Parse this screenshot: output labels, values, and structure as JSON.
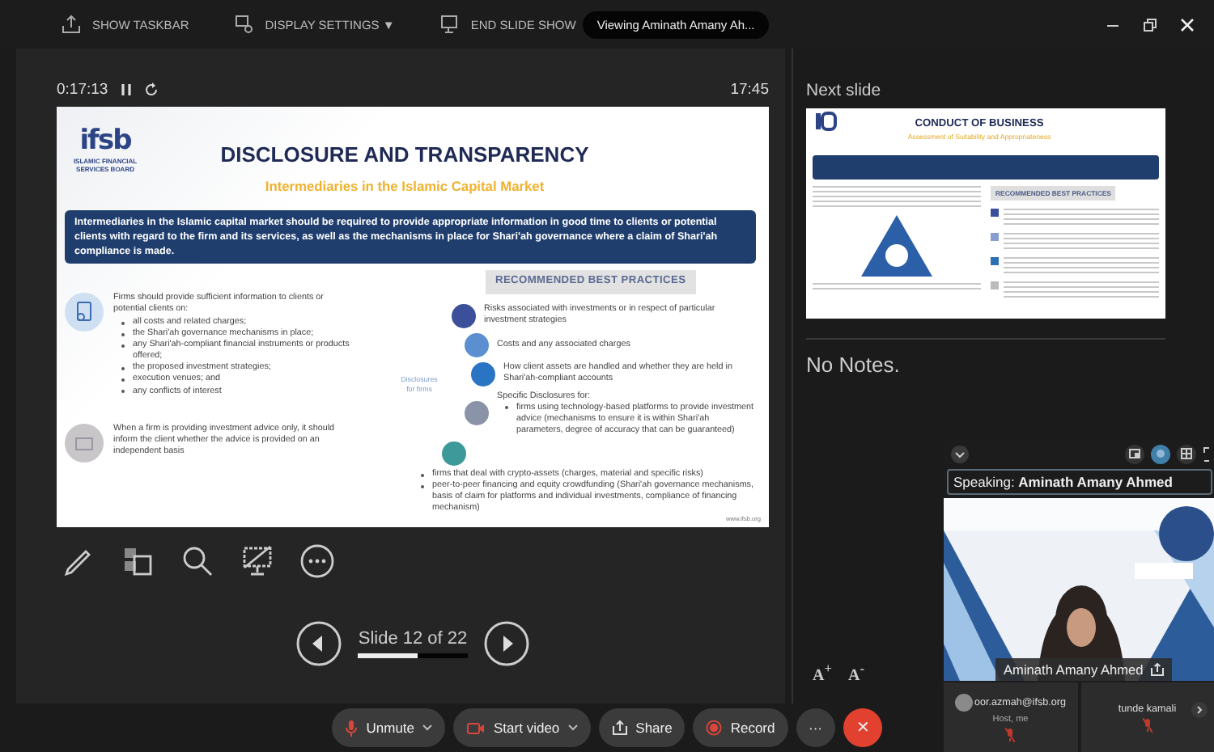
{
  "top_bar": {
    "items": [
      {
        "label": "SHOW TASKBAR",
        "kind": "taskbar"
      },
      {
        "label": "DISPLAY SETTINGS ▼",
        "kind": "display"
      },
      {
        "label": "END SLIDE SHOW",
        "kind": "end"
      }
    ],
    "viewing_badge": "Viewing Aminath Amany Ah..."
  },
  "presenter": {
    "elapsed": "0:17:13",
    "clock": "17:45"
  },
  "slide": {
    "logo": "ifsb",
    "logo_caption": "ISLAMIC FINANCIAL SERVICES BOARD",
    "title": "DISCLOSURE AND TRANSPARENCY",
    "subtitle": "Intermediaries in the Islamic Capital Market",
    "banner": "Intermediaries in the Islamic capital market should be required to provide appropriate information in good time to clients or potential clients with regard to the firm and its services, as well as the mechanisms in place for Shari'ah governance where a claim of Shari'ah compliance is made.",
    "left_blocks": [
      {
        "text": "Firms should provide sufficient information to clients or potential clients on:",
        "bullets": [
          "all costs and related charges;",
          "the Shari'ah governance mechanisms in place;",
          "any Shari'ah-compliant financial instruments or products offered;",
          "the proposed investment strategies;",
          "execution venues; and",
          "any conflicts of interest"
        ]
      },
      {
        "text": "When a firm is providing investment advice only, it should inform the client whether the advice is provided on an independent basis"
      }
    ],
    "practices_heading": "RECOMMENDED BEST PRACTICES",
    "hub_label": "Disclosures for firms",
    "practices": [
      {
        "text": "Risks associated with investments or in respect of particular investment strategies",
        "color": "#3b4f9a"
      },
      {
        "text": "Costs and any associated charges",
        "color": "#5b8fd0"
      },
      {
        "text": "How client assets are handled and whether they are held in Shari'ah-compliant accounts",
        "color": "#2a74c4"
      },
      {
        "text": "Specific Disclosures for:",
        "color": "#8a93a8",
        "bullets": [
          "firms using technology-based platforms to provide investment advice (mechanisms to ensure it is within Shari'ah parameters, degree of accuracy that can be guaranteed)"
        ]
      }
    ],
    "more_bullets": [
      "firms that deal with crypto-assets (charges, material and specific risks)",
      "peer-to-peer financing and equity crowdfunding (Shari'ah governance mechanisms, basis of claim for platforms and individual investments, compliance of financing mechanism)"
    ],
    "footer": "www.ifsb.org"
  },
  "slide_nav": {
    "label": "Slide 12 of 22",
    "level": 0.55
  },
  "next_slide": {
    "heading": "Next slide",
    "title": "CONDUCT OF BUSINESS",
    "subtitle": "Assessment of Suitability and Appropriateness",
    "practices_heading": "RECOMMENDED BEST PRACTICES"
  },
  "notes": "No Notes.",
  "text_size_buttons": [
    "A$^{+}$",
    "A$^{-}$"
  ],
  "video": {
    "layouts": [
      {
        "selected": false
      },
      {
        "selected": true
      },
      {
        "selected": false
      }
    ],
    "speaking": "Speaking: **Aminath Amany Ahmed**",
    "name_tag": "Aminath Amany Ahmed",
    "participants": [
      {
        "name": "oor.azmah@ifsb.org",
        "role": "Host, me",
        "muted": true,
        "avatar": true
      },
      {
        "name": "tunde kamali",
        "muted": true,
        "avatar": false
      }
    ]
  },
  "controls": [
    {
      "kind": "mic",
      "label": "Unmute"
    },
    {
      "kind": "video",
      "label": "Start video"
    },
    {
      "kind": "share",
      "label": "Share"
    },
    {
      "kind": "record",
      "label": "Record"
    },
    {
      "kind": "more",
      "label": "···"
    },
    {
      "kind": "leave",
      "label": "✕"
    }
  ]
}
